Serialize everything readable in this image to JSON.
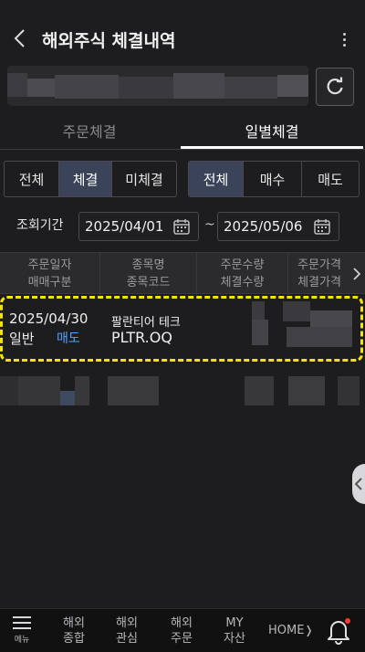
{
  "header": {
    "title": "해외주식 체결내역",
    "back_icon": "chevron-left-icon",
    "more_icon": "more-vertical-icon"
  },
  "account": {
    "refresh_icon": "refresh-icon"
  },
  "tabs": [
    {
      "label": "주문체결",
      "active": false
    },
    {
      "label": "일별체결",
      "active": true
    }
  ],
  "filter_status": [
    {
      "label": "전체",
      "active": false
    },
    {
      "label": "체결",
      "active": true
    },
    {
      "label": "미체결",
      "active": false
    }
  ],
  "filter_side": [
    {
      "label": "전체",
      "active": true
    },
    {
      "label": "매수",
      "active": false
    },
    {
      "label": "매도",
      "active": false
    }
  ],
  "period": {
    "label": "조회기간",
    "start": "2025/04/01",
    "separator": "~",
    "end": "2025/05/06"
  },
  "table": {
    "columns": [
      [
        "주문일자",
        "매매구분"
      ],
      [
        "종목명",
        "종목코드"
      ],
      [
        "주문수량",
        "체결수량"
      ],
      [
        "주문가격",
        "체결가격"
      ]
    ],
    "rows": [
      {
        "date": "2025/04/30",
        "type": "일반",
        "side": "매도",
        "name": "팔란티어 테크",
        "code": "PLTR.OQ"
      }
    ]
  },
  "bottom_nav": {
    "menu_label": "메뉴",
    "items": [
      [
        "해외",
        "종합"
      ],
      [
        "해외",
        "관심"
      ],
      [
        "해외",
        "주문"
      ],
      [
        "MY",
        "자산"
      ]
    ],
    "home_label": "HOME",
    "notification_icon": "bell-icon"
  },
  "colors": {
    "background": "#1d1d1f",
    "sell": "#5aa0ff",
    "highlight": "#f5e400",
    "active_segment": "#3a4357"
  }
}
